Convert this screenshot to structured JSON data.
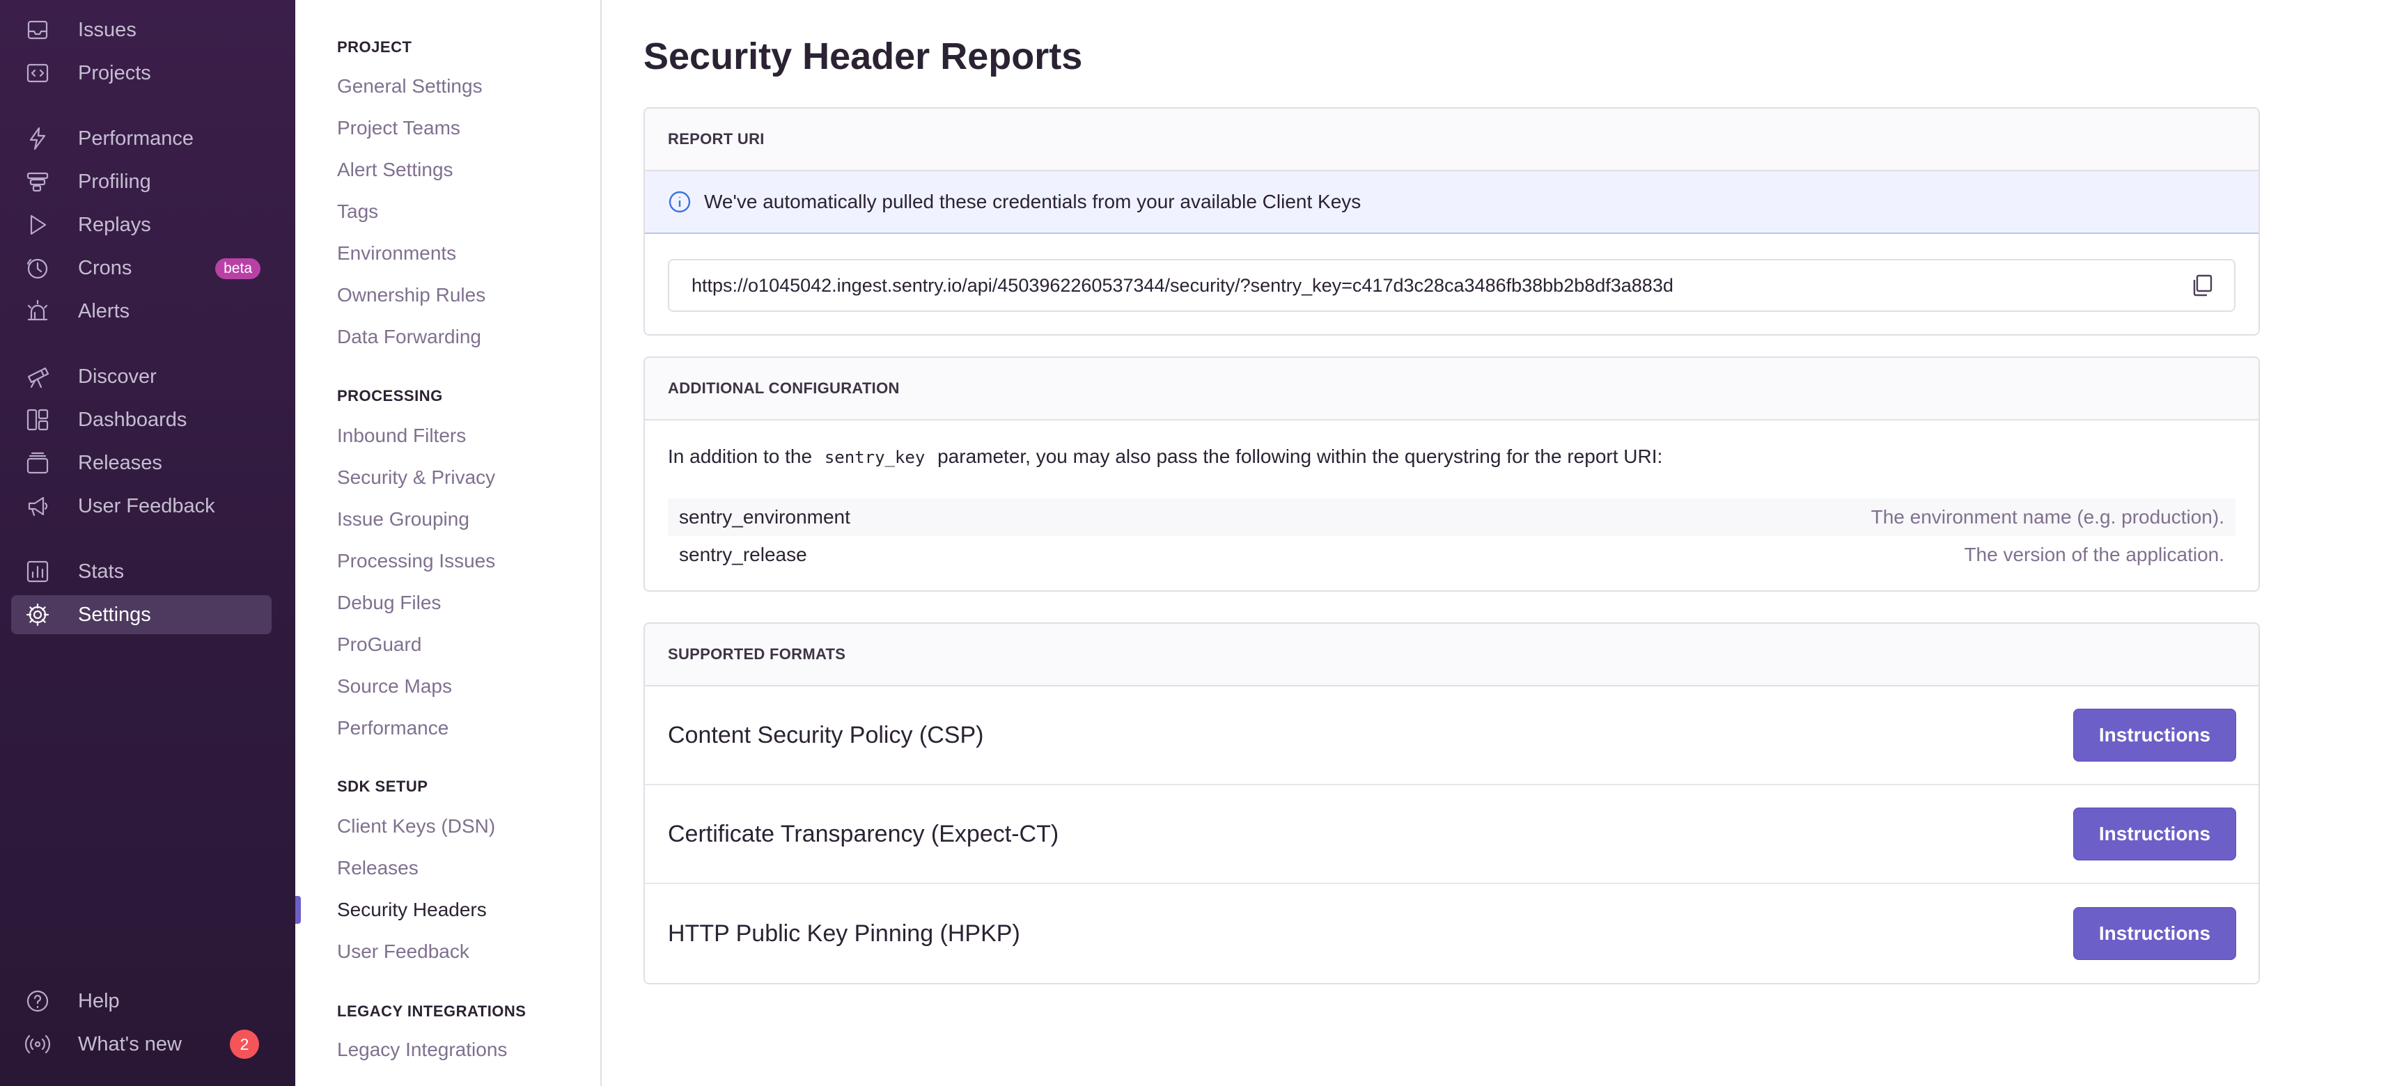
{
  "sidebar": {
    "items": [
      {
        "label": "Issues",
        "icon": "inbox-icon"
      },
      {
        "label": "Projects",
        "icon": "code-icon"
      },
      {
        "label": "Performance",
        "icon": "lightning-icon"
      },
      {
        "label": "Profiling",
        "icon": "profiling-icon"
      },
      {
        "label": "Replays",
        "icon": "play-icon"
      },
      {
        "label": "Crons",
        "icon": "timer-icon",
        "badge": "beta"
      },
      {
        "label": "Alerts",
        "icon": "siren-icon"
      },
      {
        "label": "Discover",
        "icon": "telescope-icon"
      },
      {
        "label": "Dashboards",
        "icon": "dashboard-icon"
      },
      {
        "label": "Releases",
        "icon": "package-icon"
      },
      {
        "label": "User Feedback",
        "icon": "megaphone-icon"
      },
      {
        "label": "Stats",
        "icon": "stats-icon"
      },
      {
        "label": "Settings",
        "icon": "gear-icon",
        "active": true
      }
    ],
    "footer": [
      {
        "label": "Help",
        "icon": "question-icon"
      },
      {
        "label": "What's new",
        "icon": "broadcast-icon",
        "count": "2"
      }
    ]
  },
  "subnav": {
    "sections": [
      {
        "title": "PROJECT",
        "links": [
          "General Settings",
          "Project Teams",
          "Alert Settings",
          "Tags",
          "Environments",
          "Ownership Rules",
          "Data Forwarding"
        ]
      },
      {
        "title": "PROCESSING",
        "links": [
          "Inbound Filters",
          "Security & Privacy",
          "Issue Grouping",
          "Processing Issues",
          "Debug Files",
          "ProGuard",
          "Source Maps",
          "Performance"
        ]
      },
      {
        "title": "SDK SETUP",
        "links": [
          "Client Keys (DSN)",
          "Releases",
          "Security Headers",
          "User Feedback"
        ]
      },
      {
        "title": "LEGACY INTEGRATIONS",
        "links": [
          "Legacy Integrations"
        ]
      }
    ],
    "active": "Security Headers"
  },
  "main": {
    "title": "Security Header Reports",
    "report_uri": {
      "heading": "REPORT URI",
      "info": "We've automatically pulled these credentials from your available Client Keys",
      "uri": "https://o1045042.ingest.sentry.io/api/4503962260537344/security/?sentry_key=c417d3c28ca3486fb38bb2b8df3a883d"
    },
    "additional": {
      "heading": "ADDITIONAL CONFIGURATION",
      "text_before": "In addition to the",
      "code": "sentry_key",
      "text_after": "parameter, you may also pass the following within the querystring for the report URI:",
      "params": [
        {
          "key": "sentry_environment",
          "desc": "The environment name (e.g. production)."
        },
        {
          "key": "sentry_release",
          "desc": "The version of the application."
        }
      ]
    },
    "formats": {
      "heading": "SUPPORTED FORMATS",
      "button_label": "Instructions",
      "rows": [
        "Content Security Policy (CSP)",
        "Certificate Transparency (Expect-CT)",
        "HTTP Public Key Pinning (HPKP)"
      ]
    }
  },
  "colors": {
    "sidebar_bg": "#2f1a3c",
    "accent": "#6c5fc7",
    "info_bg": "#f0f3ff",
    "badge_beta": "#b941a6",
    "badge_count": "#f55459"
  }
}
